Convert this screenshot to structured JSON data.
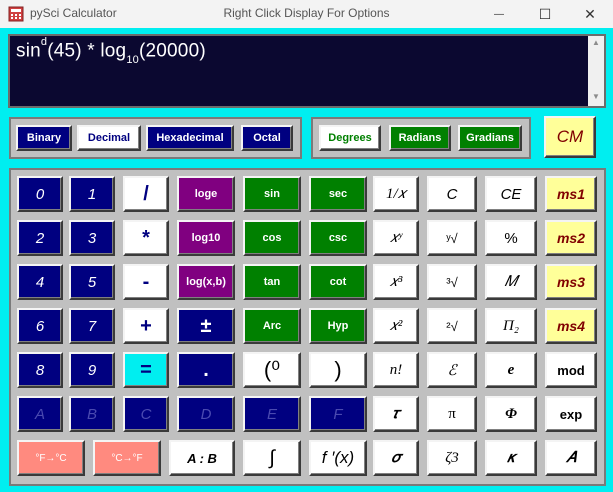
{
  "window": {
    "app_name": "pySci Calculator",
    "title": "Right Click Display For Options",
    "minimize_glyph": "—",
    "maximize_glyph": "☐",
    "close_glyph": "✕",
    "icon": "calculator-icon"
  },
  "display": {
    "func": "sin",
    "func_sup": "d",
    "arg1": "(45) * log",
    "log_sub": "10",
    "arg2": "(20000)",
    "scroll_up_glyph": "▲",
    "scroll_down_glyph": "▼"
  },
  "base_modes": [
    "Binary",
    "Decimal",
    "Hexadecimal",
    "Octal"
  ],
  "angle_modes": [
    "Degrees",
    "Radians",
    "Gradians"
  ],
  "cm_label": "CM",
  "keys": {
    "d0": "0",
    "d1": "1",
    "d2": "2",
    "d3": "3",
    "d4": "4",
    "d5": "5",
    "d6": "6",
    "d7": "7",
    "d8": "8",
    "d9": "9",
    "hexA": "A",
    "hexB": "B",
    "hexC": "C",
    "hexD": "D",
    "hexE": "E",
    "hexF": "F",
    "divide": "/",
    "multiply": "*",
    "minus": "-",
    "plus": "+",
    "equals": "=",
    "loge": "loge",
    "log10": "log10",
    "logxb": "log(x,b)",
    "plusminus": "±",
    "decimal": ".",
    "sin": "sin",
    "cos": "cos",
    "tan": "tan",
    "arc": "Arc",
    "sec": "sec",
    "csc": "csc",
    "cot": "cot",
    "hyp": "Hyp",
    "reciprocal": "1/𝑥",
    "x_pow_y": "𝑥ʸ",
    "x_cubed": "𝑥³",
    "x_squared": "𝑥²",
    "clear": "C",
    "y_root": "ʸ√",
    "cube_root": "³√",
    "sqrt": "²√",
    "clear_entry": "CE",
    "percent": "%",
    "mean": "𝑀",
    "product": "Π₂",
    "ms1": "ms1",
    "ms2": "ms2",
    "ms3": "ms3",
    "ms4": "ms4",
    "degree_paren": "(⁰",
    "close_paren": ")",
    "factorial": "n!",
    "epsilon": "ℰ",
    "e_const": "e",
    "mod": "mod",
    "tau": "𝜏",
    "pi": "π",
    "phi": "Φ",
    "exp": "exp",
    "f_to_c": "°F→°C",
    "c_to_f": "°C→°F",
    "ratio": "A : B",
    "integral": "∫",
    "derivative": "f ′(x)",
    "sigma": "𝜎",
    "zeta3": "ζ3",
    "kappa": "𝜅",
    "alpha": "𝐴"
  },
  "colors": {
    "frame": "#00eef0",
    "display_bg": "#0b0830",
    "panel": "#c0c0c0",
    "navy": "#000080",
    "green": "#008000",
    "purple": "#800080",
    "memory_yellow": "#ffff99",
    "salmon": "#ff8a7f"
  }
}
